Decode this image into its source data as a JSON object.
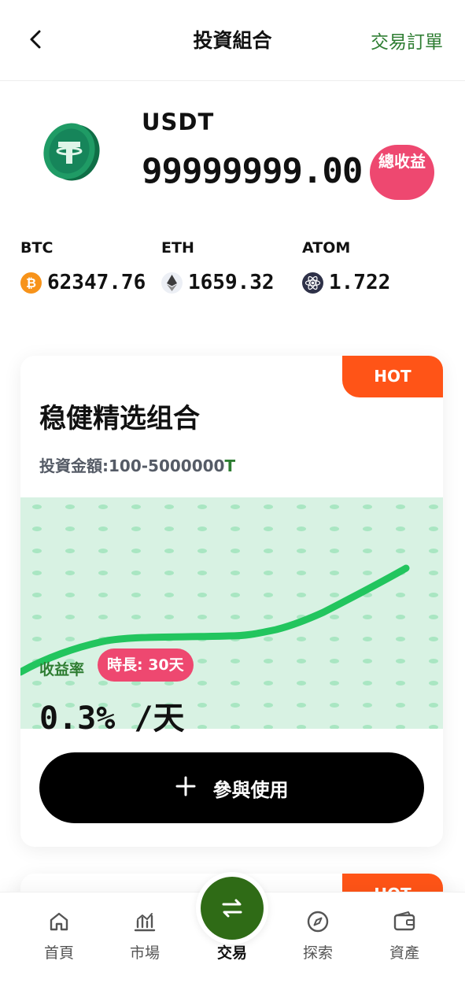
{
  "header": {
    "title": "投資組合",
    "orders_label": "交易訂單"
  },
  "balance": {
    "currency": "USDT",
    "amount": "99999999.00",
    "profit_label": "總收益",
    "logo_icon": "tether-coin-icon"
  },
  "tickers": [
    {
      "symbol": "BTC",
      "price": "62347.76",
      "icon": "bitcoin-icon",
      "color": "#f7931a"
    },
    {
      "symbol": "ETH",
      "price": "1659.32",
      "icon": "ethereum-icon",
      "color": "#627eea"
    },
    {
      "symbol": "ATOM",
      "price": "1.722",
      "icon": "cosmos-icon",
      "color": "#2e3148"
    }
  ],
  "plan": {
    "badge": "HOT",
    "name": "稳健精选组合",
    "amount_label": "投資金額:",
    "amount_range": "100-5000000",
    "amount_unit": "T",
    "rate_label": "收益率",
    "duration": "時長: 30天",
    "rate": "0.3% /天",
    "join_label": "參與使用"
  },
  "plan2": {
    "badge": "HOT"
  },
  "nav": {
    "items": [
      {
        "label": "首頁",
        "icon": "home-icon"
      },
      {
        "label": "市場",
        "icon": "market-chart-icon"
      },
      {
        "label": "交易",
        "icon": "swap-arrows-icon"
      },
      {
        "label": "探索",
        "icon": "compass-icon"
      },
      {
        "label": "資產",
        "icon": "wallet-icon"
      }
    ]
  },
  "colors": {
    "accent_green": "#2e7d32",
    "hot_orange": "#ff5417",
    "pink": "#ee4870",
    "chart_line": "#22c55e",
    "chart_bg": "#d8f2e3"
  }
}
